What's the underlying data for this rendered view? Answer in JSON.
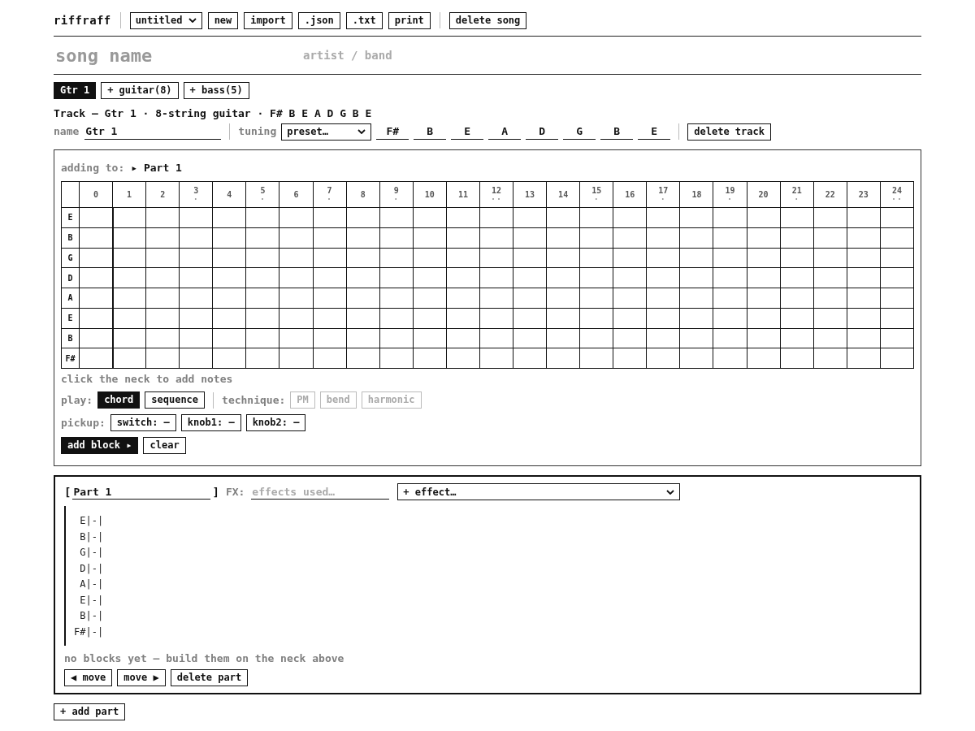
{
  "app": {
    "logo": "riffraff"
  },
  "toolbar": {
    "song_select": {
      "value": "untitled"
    },
    "buttons": [
      "new",
      "import",
      ".json",
      ".txt",
      "print"
    ],
    "delete_button": "delete song"
  },
  "song": {
    "song_name": {
      "placeholder": "song name"
    },
    "artist": {
      "placeholder": "artist / band"
    }
  },
  "track_tabs": [
    {
      "label": "Gtr 1",
      "selected": true
    }
  ],
  "add_track_buttons": [
    "+ guitar(8)",
    "+ bass(5)"
  ],
  "track": {
    "heading": "Track — Gtr 1 · 8-string guitar · F# B E A D G B E",
    "name_label": "name",
    "name_value": "Gtr 1",
    "tuning_label": "tuning",
    "tuning_preset": "preset…",
    "tuning": [
      "F#",
      "B",
      "E",
      "A",
      "D",
      "G",
      "B",
      "E"
    ],
    "delete_button": "delete track"
  },
  "neck": {
    "adding_to_label": "adding to:",
    "adding_to_target": "▸ Part 1",
    "hint": "click the neck to add notes"
  },
  "fretboard": {
    "frets": [
      {
        "label": "0"
      },
      {
        "label": "1"
      },
      {
        "label": "2"
      },
      {
        "label": "3",
        "marker": "·"
      },
      {
        "label": "4"
      },
      {
        "label": "5",
        "marker": "·"
      },
      {
        "label": "6"
      },
      {
        "label": "7",
        "marker": "·"
      },
      {
        "label": "8"
      },
      {
        "label": "9",
        "marker": "·"
      },
      {
        "label": "10"
      },
      {
        "label": "11"
      },
      {
        "label": "12",
        "marker": "··"
      },
      {
        "label": "13"
      },
      {
        "label": "14"
      },
      {
        "label": "15",
        "marker": "·"
      },
      {
        "label": "16"
      },
      {
        "label": "17",
        "marker": "·"
      },
      {
        "label": "18"
      },
      {
        "label": "19",
        "marker": "·"
      },
      {
        "label": "20"
      },
      {
        "label": "21",
        "marker": "·"
      },
      {
        "label": "22"
      },
      {
        "label": "23"
      },
      {
        "label": "24",
        "marker": "··"
      }
    ],
    "strings": [
      "E",
      "B",
      "G",
      "D",
      "A",
      "E",
      "B",
      "F#"
    ]
  },
  "play": {
    "label": "play:",
    "options": [
      {
        "label": "chord",
        "selected": true
      },
      {
        "label": "sequence",
        "selected": false
      }
    ]
  },
  "technique": {
    "label": "technique:",
    "options": [
      {
        "label": "PM",
        "disabled": true
      },
      {
        "label": "bend",
        "disabled": true
      },
      {
        "label": "harmonic",
        "disabled": true
      }
    ]
  },
  "pickup": {
    "label": "pickup:",
    "buttons": [
      "switch: —",
      "knob1: —",
      "knob2: —"
    ]
  },
  "block_actions": [
    {
      "label": "add block ▸",
      "kind": "primary"
    },
    {
      "label": "clear",
      "kind": "plain"
    }
  ],
  "parts": [
    {
      "brackets": [
        "[",
        "]"
      ],
      "name": "Part 1",
      "fx_label": "FX:",
      "fx_placeholder": "effects used…",
      "effect_select": "+ effect…",
      "tab_lines": [
        "E|-|",
        "B|-|",
        "G|-|",
        "D|-|",
        "A|-|",
        "E|-|",
        "B|-|",
        "F#|-|"
      ],
      "empty_note": "no blocks yet — build them on the neck above",
      "buttons": [
        "◀ move",
        "move ▶",
        "delete part"
      ]
    }
  ],
  "add_part_button": "+ add part"
}
